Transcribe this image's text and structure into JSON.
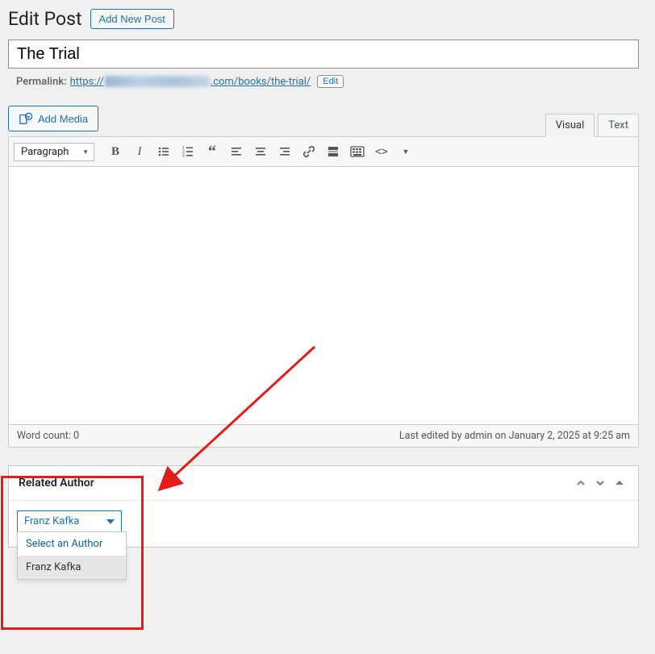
{
  "header": {
    "page_title": "Edit Post",
    "add_new_label": "Add New Post"
  },
  "post": {
    "title_value": "The Trial"
  },
  "permalink": {
    "label": "Permalink:",
    "prefix": "https://",
    "suffix": ".com/books/the-trial/",
    "edit_label": "Edit"
  },
  "media": {
    "add_media_label": "Add Media"
  },
  "editor": {
    "tabs": {
      "visual": "Visual",
      "text": "Text"
    },
    "format_selector": "Paragraph",
    "word_count_label": "Word count: 0",
    "last_edited": "Last edited by admin on January 2, 2025 at 9:25 am"
  },
  "metabox": {
    "title": "Related Author",
    "selected": "Franz Kafka",
    "options": [
      {
        "label": "Select an Author",
        "is_placeholder": true
      },
      {
        "label": "Franz Kafka",
        "is_selected": true
      }
    ]
  }
}
